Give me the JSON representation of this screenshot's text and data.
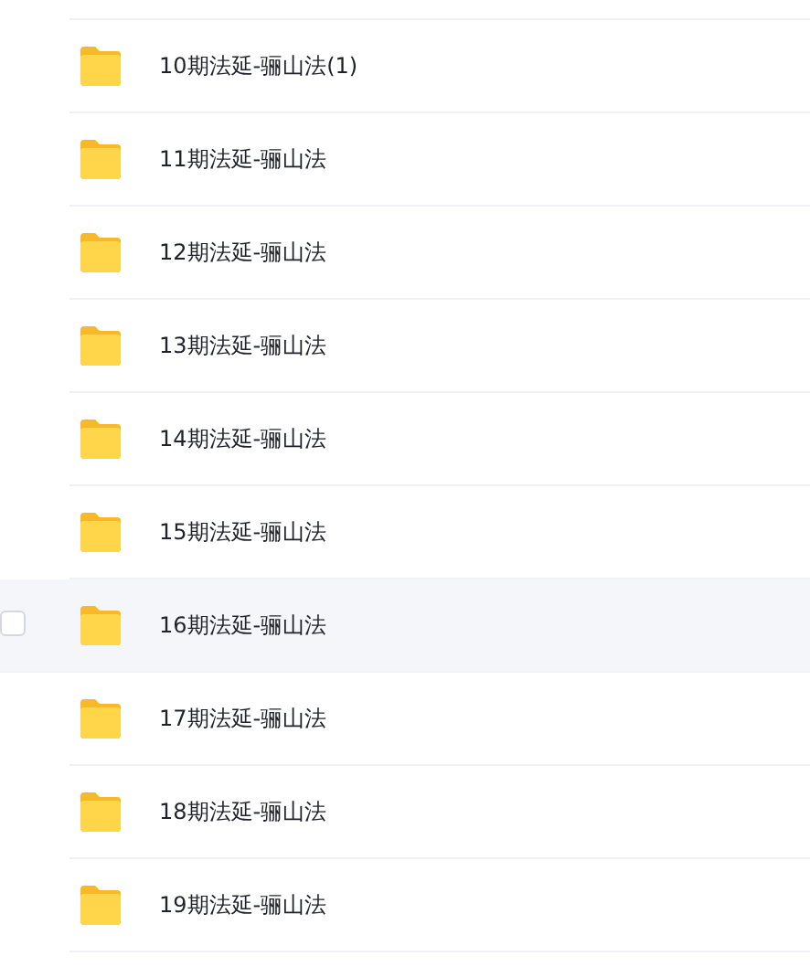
{
  "files": [
    {
      "name": "10期法延-骊山法(1)",
      "hovered": false
    },
    {
      "name": "11期法延-骊山法",
      "hovered": false
    },
    {
      "name": "12期法延-骊山法",
      "hovered": false
    },
    {
      "name": "13期法延-骊山法",
      "hovered": false
    },
    {
      "name": "14期法延-骊山法",
      "hovered": false
    },
    {
      "name": "15期法延-骊山法",
      "hovered": false
    },
    {
      "name": "16期法延-骊山法",
      "hovered": true
    },
    {
      "name": "17期法延-骊山法",
      "hovered": false
    },
    {
      "name": "18期法延-骊山法",
      "hovered": false
    },
    {
      "name": "19期法延-骊山法",
      "hovered": false
    }
  ]
}
